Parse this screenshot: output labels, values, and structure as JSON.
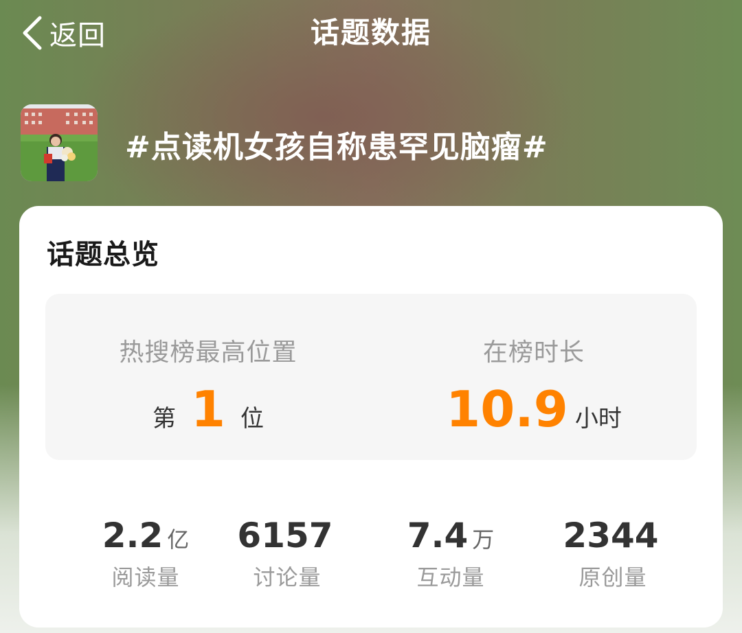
{
  "nav": {
    "back_label": "返回",
    "title": "话题数据"
  },
  "topic": {
    "title": "#点读机女孩自称患罕见脑瘤#",
    "thumbnail_icon": "topic-photo-thumbnail"
  },
  "overview": {
    "heading": "话题总览",
    "top_position": {
      "label": "热搜榜最高位置",
      "prefix": "第",
      "value": "1",
      "suffix": "位"
    },
    "duration": {
      "label": "在榜时长",
      "value": "10.9",
      "unit": "小时"
    },
    "stats": [
      {
        "value": "2.2",
        "unit": "亿",
        "label": "阅读量"
      },
      {
        "value": "6157",
        "unit": "",
        "label": "讨论量"
      },
      {
        "value": "7.4",
        "unit": "万",
        "label": "互动量"
      },
      {
        "value": "2344",
        "unit": "",
        "label": "原创量"
      }
    ]
  },
  "colors": {
    "accent": "#ff8200",
    "card_bg": "#ffffff",
    "panel_bg": "#f6f6f6",
    "text_primary": "#333333",
    "text_muted": "#9a9a9a"
  }
}
